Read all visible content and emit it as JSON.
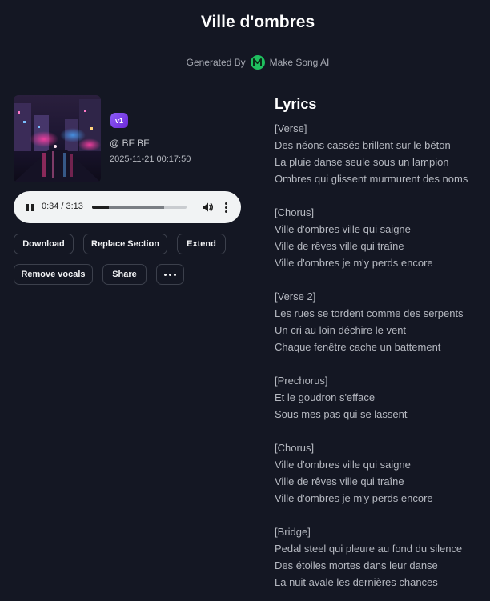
{
  "song": {
    "title": "Ville d'ombres",
    "generated_by_label": "Generated By",
    "brand_name": "Make Song AI",
    "brand_logo_letter": "M",
    "version_badge": "v1",
    "author": "@ BF BF",
    "date": "2025-11-21 00:17:50"
  },
  "player": {
    "current_time": "0:34",
    "separator": "/",
    "duration": "3:13",
    "played_fraction": 0.176,
    "buffered_fraction": 0.76
  },
  "actions": {
    "download": "Download",
    "replace_section": "Replace Section",
    "extend": "Extend",
    "remove_vocals": "Remove vocals",
    "share": "Share"
  },
  "lyrics": {
    "title": "Lyrics",
    "stanzas": [
      [
        "[Verse]",
        "Des néons cassés brillent sur le béton",
        "La pluie danse seule sous un lampion",
        "Ombres qui glissent murmurent des noms"
      ],
      [
        "[Chorus]",
        "Ville d'ombres ville qui saigne",
        "Ville de rêves ville qui traîne",
        "Ville d'ombres je m'y perds encore"
      ],
      [
        "[Verse 2]",
        "Les rues se tordent comme des serpents",
        "Un cri au loin déchire le vent",
        "Chaque fenêtre cache un battement"
      ],
      [
        "[Prechorus]",
        "Et le goudron s'efface",
        "Sous mes pas qui se lassent"
      ],
      [
        "[Chorus]",
        "Ville d'ombres ville qui saigne",
        "Ville de rêves ville qui traîne",
        "Ville d'ombres je m'y perds encore"
      ],
      [
        "[Bridge]",
        "Pedal steel qui pleure au fond du silence",
        "Des étoiles mortes dans leur danse",
        "La nuit avale les dernières chances"
      ]
    ]
  },
  "colors": {
    "background": "#141723",
    "accent_badge": "#7c3aed",
    "brand_green": "#1fbf5f"
  }
}
